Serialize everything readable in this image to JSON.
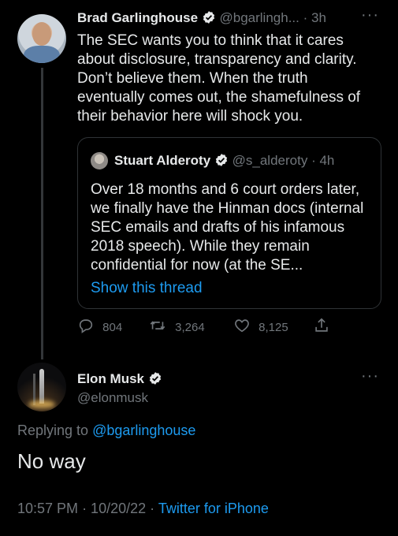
{
  "colors": {
    "background": "#000000",
    "text": "#e7e9ea",
    "muted": "#71767b",
    "accent": "#1d9bf0",
    "border": "#2f3336"
  },
  "tweet1": {
    "name": "Brad Garlinghouse",
    "handle": "@bgarlingh...",
    "time": "· 3h",
    "text": "The SEC wants you to think that it cares about disclosure, transparency and clarity. Don’t believe them. When the truth eventually comes out, the shamefulness of their behavior here will shock you.",
    "more_icon": "···",
    "quote": {
      "name": "Stuart Alderoty",
      "handle": "@s_alderoty",
      "time": "· 4h",
      "text": "Over 18 months and 6 court orders later, we finally have the Hinman docs (internal SEC emails and drafts of his infamous 2018 speech). While they remain confidential for now (at the SE...",
      "show_thread": "Show this thread"
    },
    "actions": {
      "replies": "804",
      "retweets": "3,264",
      "likes": "8,125"
    }
  },
  "tweet2": {
    "name": "Elon Musk",
    "handle": "@elonmusk",
    "more_icon": "···",
    "replying_prefix": "Replying to",
    "replying_to": "@bgarlinghouse",
    "text": "No way",
    "time": "10:57 PM",
    "date": "· 10/20/22 ·",
    "source": "Twitter for iPhone"
  }
}
